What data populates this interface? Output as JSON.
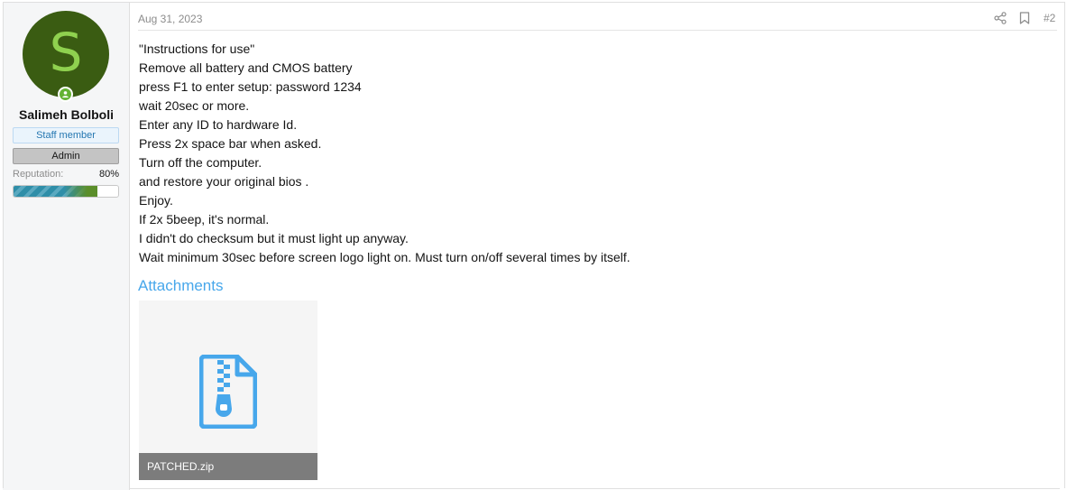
{
  "user": {
    "avatar_letter": "S",
    "name": "Salimeh Bolboli",
    "badge_staff": "Staff member",
    "badge_admin": "Admin",
    "reputation_label": "Reputation:",
    "reputation_value": "80%",
    "reputation_fraction": 0.8,
    "online": true
  },
  "post": {
    "date": "Aug 31, 2023",
    "number": "#2",
    "lines": [
      "\"Instructions for use\"",
      "Remove all battery and CMOS battery",
      "press F1 to enter setup: password 1234",
      "wait 20sec or more.",
      "Enter any ID to hardware Id.",
      "Press 2x space bar when asked.",
      "Turn off the computer.",
      "and restore your original bios .",
      "Enjoy.",
      "If 2x 5beep, it's normal.",
      "I didn't do checksum but it must light up anyway.",
      "Wait minimum 30sec before screen logo light on. Must turn on/off several times by itself."
    ],
    "attachments_title": "Attachments",
    "attachments": [
      {
        "name": "PATCHED.zip",
        "icon": "zip-file-icon"
      }
    ]
  },
  "colors": {
    "accent": "#47a7eb",
    "avatar_bg": "#3a5c12",
    "avatar_letter": "#8fd14f",
    "online": "#63b233"
  }
}
